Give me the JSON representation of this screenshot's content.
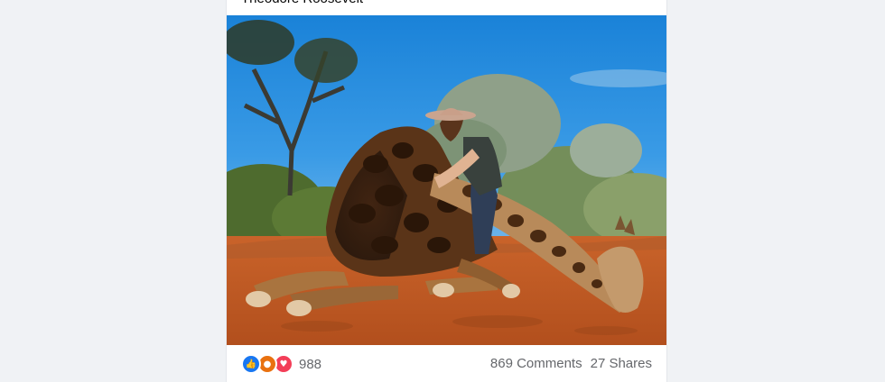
{
  "post": {
    "caption_text": "Theodore Roosevelt",
    "photo": {
      "alt": "A smiling woman in a hat hugging a large dead giraffe lying on red soil under a blue sky with acacia trees"
    },
    "reactions": {
      "icons": [
        "like-icon",
        "angry-icon",
        "love-icon"
      ],
      "count": "988"
    },
    "stats": {
      "comments": "869 Comments",
      "shares": "27 Shares"
    }
  },
  "colors": {
    "page_background": "#f0f2f5",
    "card_background": "#ffffff",
    "muted_text": "#65676b",
    "like_blue": "#1877f2",
    "angry_orange": "#e9710f",
    "love_red": "#f33e58"
  }
}
